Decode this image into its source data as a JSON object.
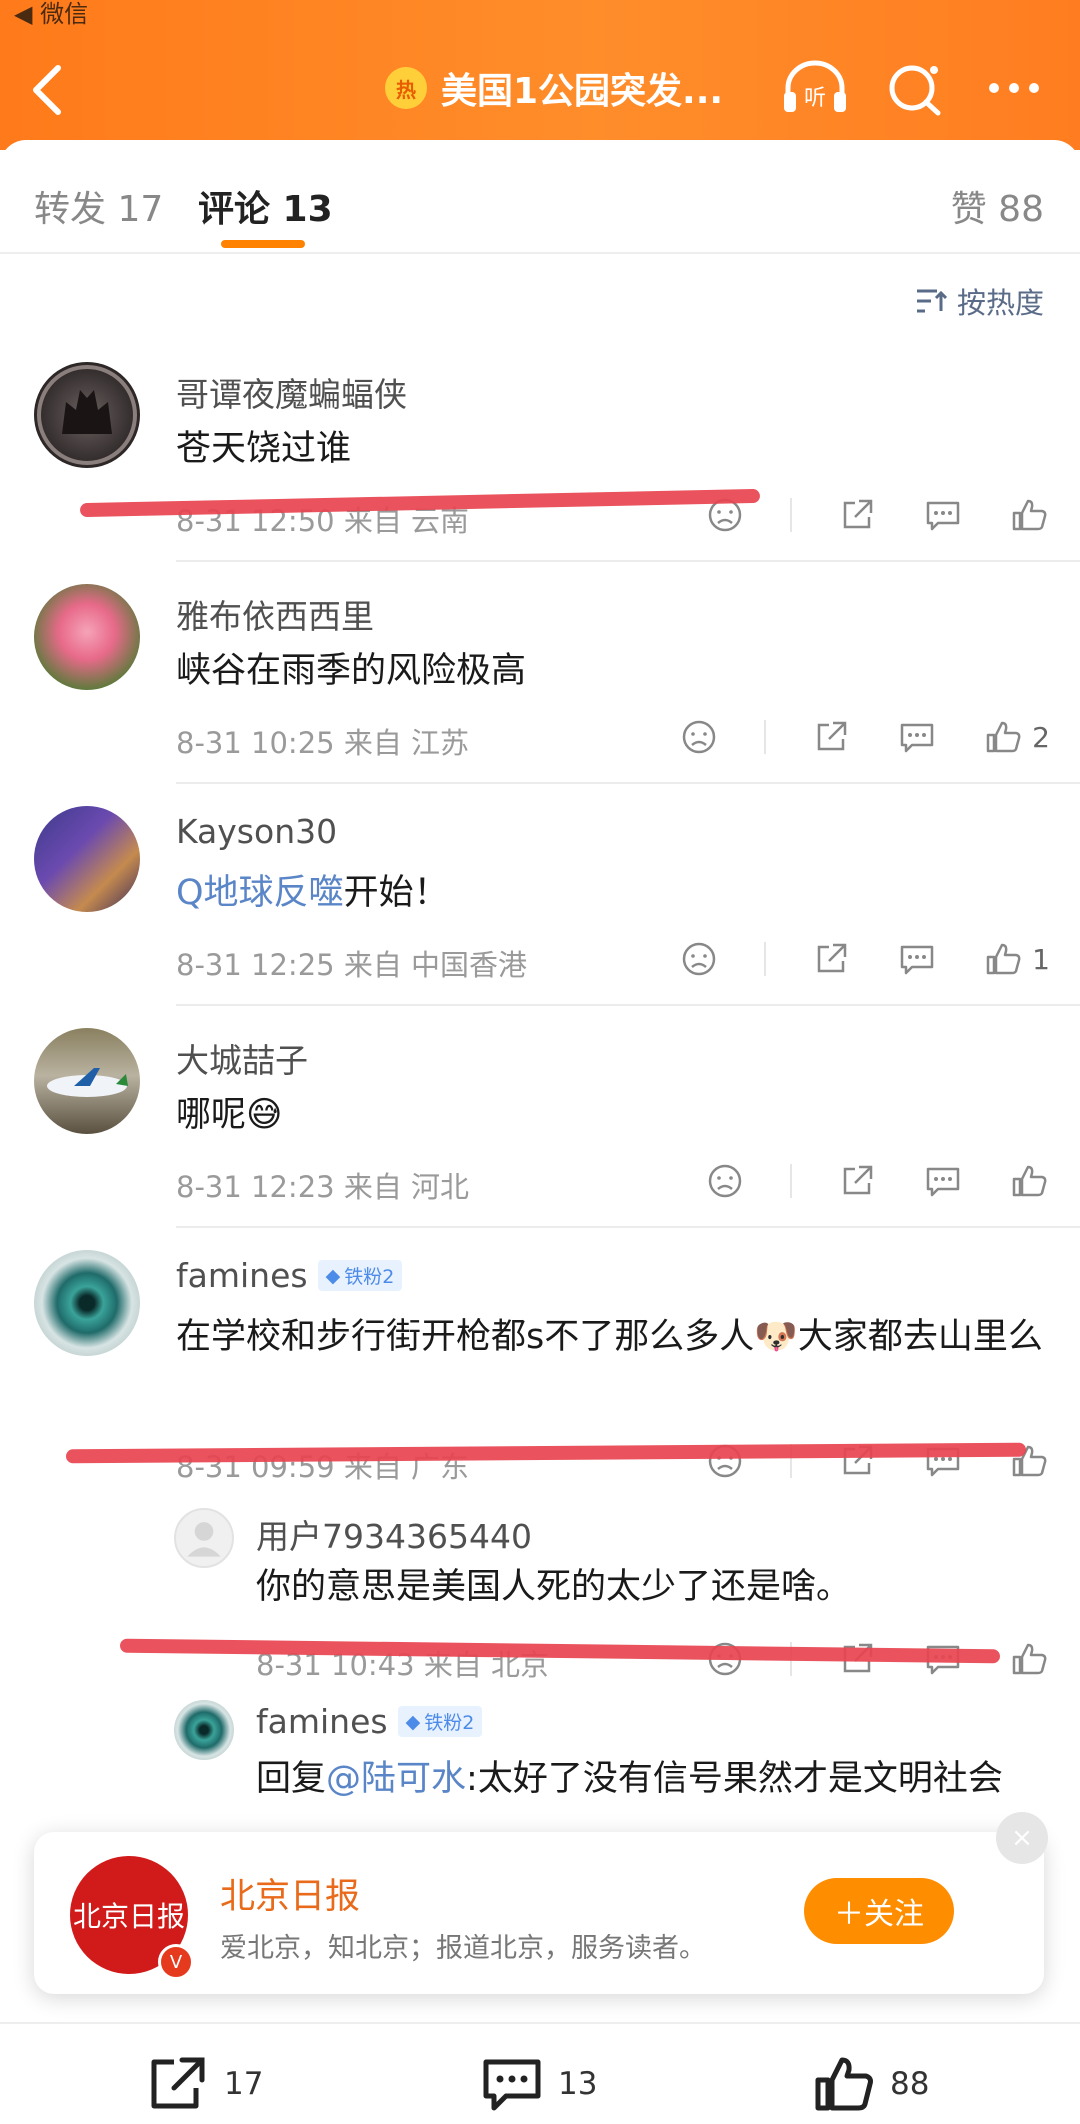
{
  "status_bar": {
    "back_label": "◀ 微信"
  },
  "header": {
    "hot_icon": "热",
    "title": "美国1公园突发...",
    "listen_label": "听"
  },
  "tabs": {
    "repost": "转发 17",
    "comments": "评论 13",
    "likes": "赞 88"
  },
  "sort": {
    "label": "按热度"
  },
  "comments": [
    {
      "user": "哥谭夜魔蝙蝠侠",
      "text": "苍天饶过谁",
      "time": "8-31 12:50",
      "location": "来自 云南",
      "likes": ""
    },
    {
      "user": "雅布依西西里",
      "text": "峡谷在雨季的风险极高",
      "time": "8-31 10:25",
      "location": "来自 江苏",
      "likes": "2"
    },
    {
      "user": "Kayson30",
      "topic": "Q地球反噬",
      "text_after": "开始！",
      "time": "8-31 12:25",
      "location": "来自 中国香港",
      "likes": "1"
    },
    {
      "user": "大城喆子",
      "text": "哪呢",
      "emoji": "😅",
      "time": "8-31 12:23",
      "location": "来自 河北",
      "likes": ""
    },
    {
      "user": "famines",
      "badge": "铁粉2",
      "text_a": "在学校和步行街开枪都s不了那么多人",
      "emoji": "🐶",
      "text_b": "大家都去山里么",
      "time": "8-31 09:59",
      "location": "来自 广东",
      "likes": ""
    }
  ],
  "replies": [
    {
      "user": "用户7934365440",
      "text": "你的意思是美国人死的太少了还是啥。",
      "time": "8-31 10:43",
      "location": "来自 北京"
    },
    {
      "user": "famines",
      "badge": "铁粉2",
      "prefix": "回复",
      "mention": "@陆可水",
      "text": ":太好了没有信号果然才是文明社会"
    }
  ],
  "card": {
    "logo_text": "北京日报",
    "verified_mark": "V",
    "name": "北京日报",
    "desc": "爱北京，知北京；报道北京，服务读者。",
    "follow_label": "＋关注",
    "close": "×"
  },
  "bottom_bar": {
    "repost_count": "17",
    "comment_count": "13",
    "like_count": "88"
  },
  "colors": {
    "accent": "#ff8200",
    "header": "#ff7a1a",
    "link": "#5a86c8",
    "annotation_red": "#e8434f"
  }
}
